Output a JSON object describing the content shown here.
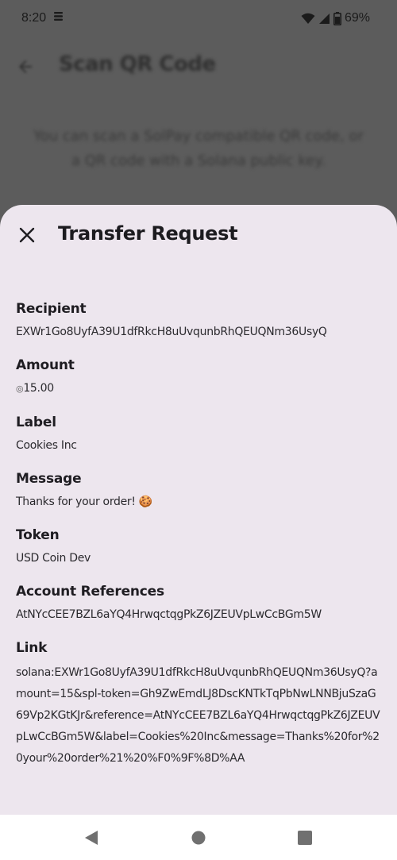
{
  "status_bar": {
    "time": "8:20",
    "battery_percent": "69%",
    "icons": [
      "notification-icon",
      "wifi-icon",
      "cellular-icon",
      "battery-icon"
    ]
  },
  "background_screen": {
    "title": "Scan QR Code",
    "description": "You can scan a SolPay compatible QR code, or a QR code with a Solana public key."
  },
  "sheet": {
    "title": "Transfer Request",
    "close_icon": "close-icon",
    "fields": [
      {
        "label": "Recipient",
        "value": "EXWr1Go8UyfA39U1dfRkcH8uUvqunbRhQEUQNm36UsyQ"
      },
      {
        "label": "Amount",
        "token_glyph": "◎",
        "value": "15.00"
      },
      {
        "label": "Label",
        "value": "Cookies Inc"
      },
      {
        "label": "Message",
        "value": "Thanks for your order! 🍪"
      },
      {
        "label": "Token",
        "value": "USD Coin Dev"
      },
      {
        "label": "Account References",
        "value": "AtNYcCEE7BZL6aYQ4HrwqctqgPkZ6JZEUVpLwCcBGm5W"
      },
      {
        "label": "Link",
        "value": "solana:EXWr1Go8UyfA39U1dfRkcH8uUvqunbRhQEUQNm36UsyQ?amount=15&spl-token=Gh9ZwEmdLJ8DscKNTkTqPbNwLNNBjuSzaG69Vp2KGtKJr&reference=AtNYcCEE7BZL6aYQ4HrwqctqgPkZ6JZEUVpLwCcBGm5W&label=Cookies%20Inc&message=Thanks%20for%20your%20order%21%20%F0%9F%8D%AA"
      }
    ]
  },
  "nav_bar": {
    "icons": [
      "back-triangle-icon",
      "home-circle-icon",
      "recents-square-icon"
    ]
  },
  "colors": {
    "scrim": "#5c5c5c",
    "sheet_background": "#ede6ee",
    "text_primary": "#1c1b1f",
    "nav_background": "#ffffff"
  }
}
